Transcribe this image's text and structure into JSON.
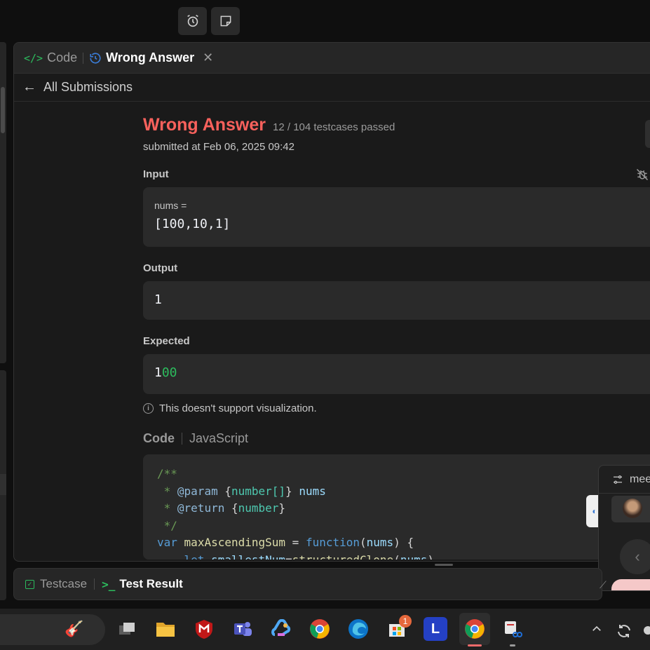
{
  "tabs": {
    "code_label": "Code",
    "active_label": "Wrong Answer"
  },
  "nav": {
    "back_label": "All Submissions"
  },
  "result": {
    "status": "Wrong Answer",
    "testcases": "12 / 104 testcases passed",
    "submitted": "submitted at Feb 06, 2025 09:42"
  },
  "input": {
    "label": "Input",
    "var_name": "nums =",
    "value": "[100,10,1]"
  },
  "output": {
    "label": "Output",
    "value": "1"
  },
  "expected": {
    "label": "Expected",
    "value_match": "1",
    "value_diff": "00"
  },
  "note": "This doesn't support visualization.",
  "code": {
    "label": "Code",
    "language": "JavaScript"
  },
  "meet": {
    "label": "mee"
  },
  "bottom": {
    "testcase_label": "Testcase",
    "result_label": "Test Result"
  },
  "taskbar": {
    "store_badge": "1",
    "l_app": "L"
  },
  "colors": {
    "error": "#f8615c",
    "success": "#2cbb5d",
    "accent_blue": "#3a7bd5"
  }
}
